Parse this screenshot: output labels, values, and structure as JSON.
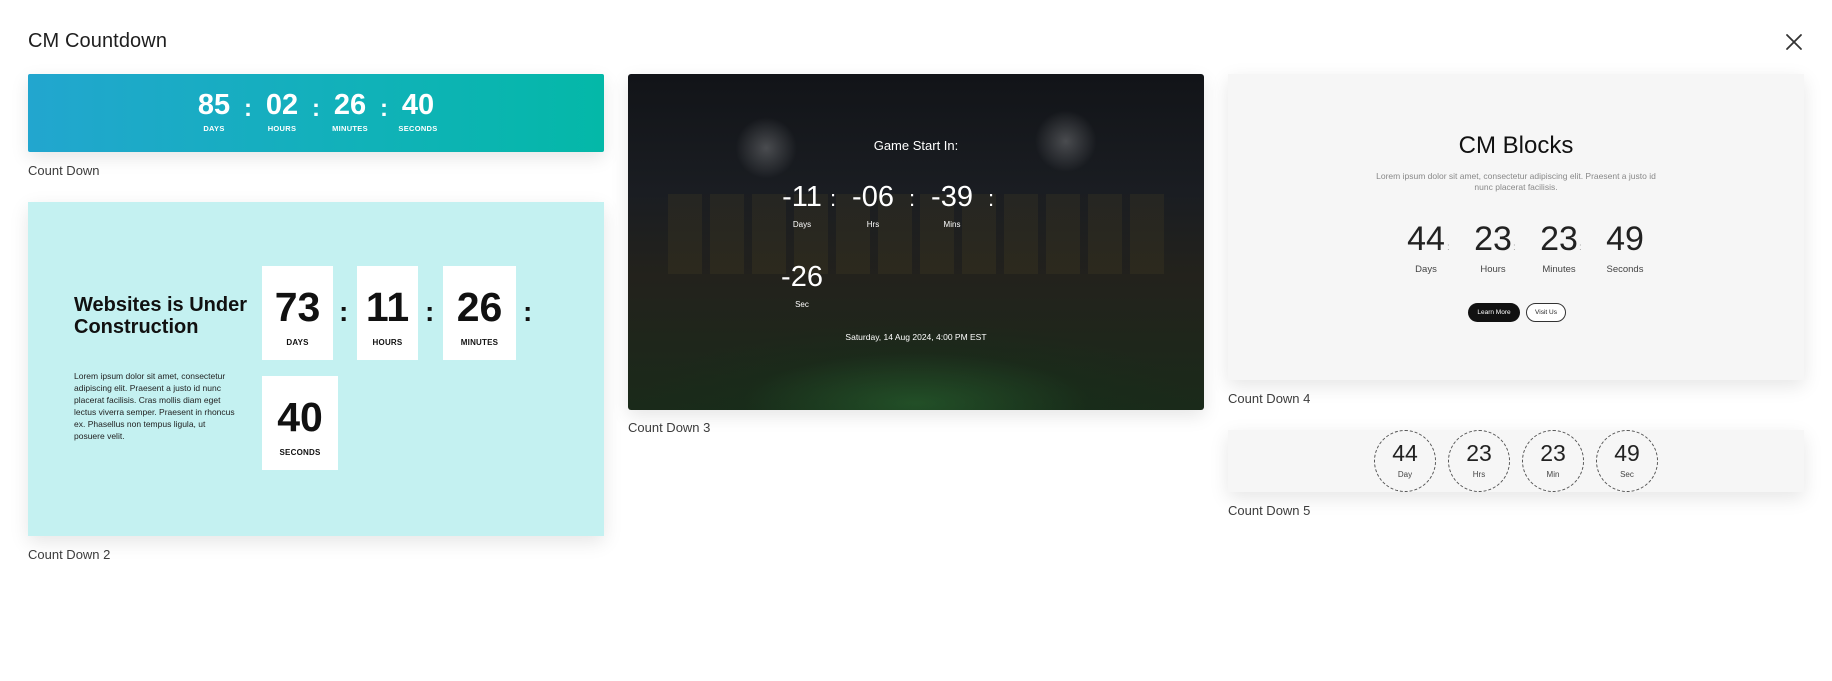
{
  "modal": {
    "title": "CM Countdown"
  },
  "cards": [
    {
      "caption": "Count Down",
      "units": [
        {
          "value": "85",
          "label": "DAYS"
        },
        {
          "value": "02",
          "label": "HOURS"
        },
        {
          "value": "26",
          "label": "MINUTES"
        },
        {
          "value": "40",
          "label": "SECONDS"
        }
      ],
      "separator": ":"
    },
    {
      "caption": "Count Down 2",
      "heading": "Websites is Under Construction",
      "body": "Lorem ipsum dolor sit amet, consectetur adipiscing elit. Praesent a justo id nunc placerat facilisis. Cras mollis diam eget lectus viverra semper. Praesent in rhoncus ex. Phasellus non tempus ligula, ut posuere velit.",
      "units": [
        {
          "value": "73",
          "label": "DAYS"
        },
        {
          "value": "11",
          "label": "HOURS"
        },
        {
          "value": "26",
          "label": "MINUTES"
        },
        {
          "value": "40",
          "label": "SECONDS"
        }
      ],
      "separator": ":"
    },
    {
      "caption": "Count Down 3",
      "title": "Game Start In:",
      "units": [
        {
          "value": "-11",
          "label": "Days"
        },
        {
          "value": "-06",
          "label": "Hrs"
        },
        {
          "value": "-39",
          "label": "Mins"
        },
        {
          "value": "-26",
          "label": "Sec"
        }
      ],
      "separator": ":",
      "date": "Saturday, 14 Aug 2024, 4:00 PM EST"
    },
    {
      "caption": "Count Down 4",
      "title": "CM Blocks",
      "body": "Lorem ipsum dolor sit amet, consectetur adipiscing elit. Praesent a justo id nunc placerat facilisis.",
      "units": [
        {
          "value": "44",
          "label": "Days"
        },
        {
          "value": "23",
          "label": "Hours"
        },
        {
          "value": "23",
          "label": "Minutes"
        },
        {
          "value": "49",
          "label": "Seconds"
        }
      ],
      "separator": ":",
      "buttons": {
        "primary": "Learn More",
        "secondary": "Visit Us"
      }
    },
    {
      "caption": "Count Down 5",
      "units": [
        {
          "value": "44",
          "label": "Day"
        },
        {
          "value": "23",
          "label": "Hrs"
        },
        {
          "value": "23",
          "label": "Min"
        },
        {
          "value": "49",
          "label": "Sec"
        }
      ]
    }
  ],
  "colors": {
    "card1_gradient_start": "#22a6cf",
    "card1_gradient_end": "#04b8a8",
    "card2_background": "#c4f1f1",
    "card4_background": "#f6f6f6"
  },
  "icons": {
    "close": "close-icon"
  }
}
